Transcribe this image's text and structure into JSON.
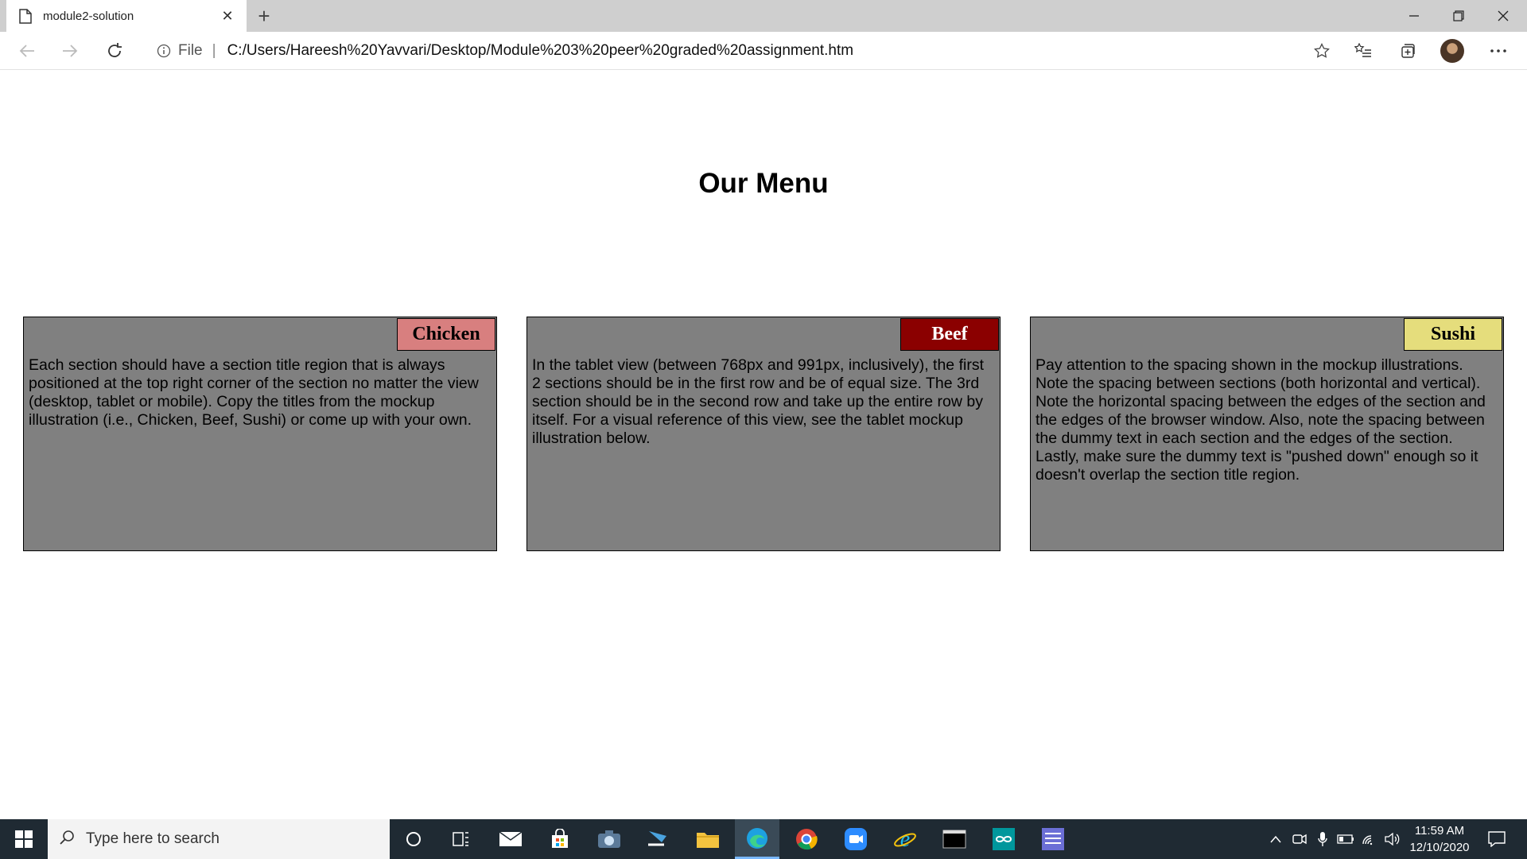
{
  "browser": {
    "tab_title": "module2-solution",
    "tab_close": "✕",
    "new_tab": "+",
    "scheme_label": "File",
    "separator": "|",
    "url": "C:/Users/Hareesh%20Yavvari/Desktop/Module%203%20peer%20graded%20assignment.htm"
  },
  "page": {
    "title": "Our Menu",
    "sections": [
      {
        "label": "Chicken",
        "label_bg": "#d87f7f",
        "label_color": "#000000",
        "text": "Each section should have a section title region that is always positioned at the top right corner of the section no matter the view (desktop, tablet or mobile). Copy the titles from the mockup illustration (i.e., Chicken, Beef, Sushi) or come up with your own."
      },
      {
        "label": "Beef",
        "label_bg": "#8b0000",
        "label_color": "#ffffff",
        "text": "In the tablet view (between 768px and 991px, inclusively), the first 2 sections should be in the first row and be of equal size. The 3rd section should be in the second row and take up the entire row by itself. For a visual reference of this view, see the tablet mockup illustration below."
      },
      {
        "label": "Sushi",
        "label_bg": "#e5dd7c",
        "label_color": "#000000",
        "text": "Pay attention to the spacing shown in the mockup illustrations. Note the spacing between sections (both horizontal and vertical). Note the horizontal spacing between the edges of the section and the edges of the browser window. Also, note the spacing between the dummy text in each section and the edges of the section. Lastly, make sure the dummy text is \"pushed down\" enough so it doesn't overlap the section title region."
      }
    ],
    "section_bg": "#808080"
  },
  "taskbar": {
    "search_placeholder": "Type here to search",
    "time": "11:59 AM",
    "date": "12/10/2020"
  }
}
